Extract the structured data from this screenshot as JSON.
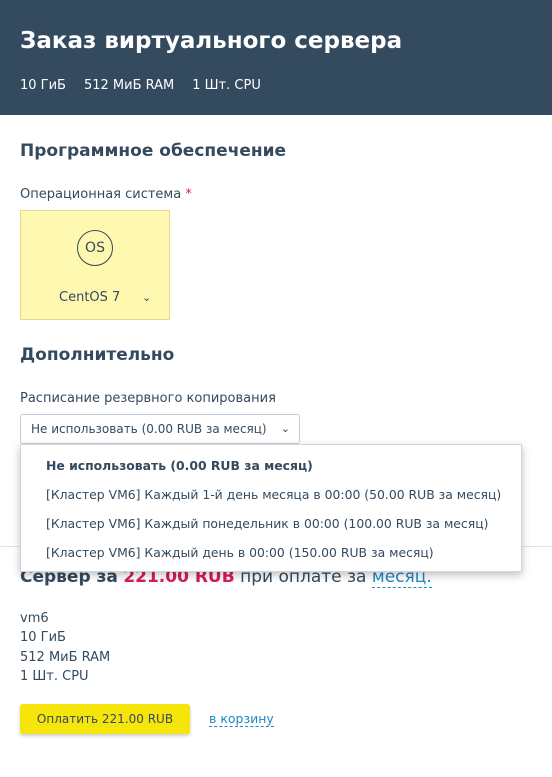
{
  "header": {
    "title": "Заказ виртуального сервера",
    "specs": [
      "10 ГиБ",
      "512 МиБ RAM",
      "1 Шт. CPU"
    ]
  },
  "software": {
    "section_title": "Программное обеспечение",
    "os_label": "Операционная система",
    "required_mark": "*",
    "os_icon_text": "OS",
    "os_value": "CentOS 7"
  },
  "additional": {
    "section_title": "Дополнительно",
    "backup_label": "Расписание резервного копирования",
    "backup_selected": "Не использовать (0.00 RUB за месяц)",
    "backup_options": [
      "Не использовать (0.00 RUB за месяц)",
      "[Кластер VM6] Каждый 1-й день месяца в 00:00 (50.00 RUB за месяц)",
      "[Кластер VM6] Каждый понедельник в 00:00 (100.00 RUB за месяц)",
      "[Кластер VM6] Каждый день в 00:00 (150.00 RUB за месяц)"
    ]
  },
  "summary": {
    "prefix": "Сервер за",
    "price": "221.00 RUB",
    "middle": "при оплате за",
    "period": "месяц.",
    "details": [
      "vm6",
      "10 ГиБ",
      "512 МиБ RAM",
      "1 Шт. CPU"
    ],
    "pay_label": "Оплатить 221.00 RUB",
    "cart_label": "в корзину"
  },
  "colors": {
    "header_bg": "#344a5e",
    "accent_price": "#d81b60",
    "link": "#1e88c7",
    "pay_button": "#f5e50a",
    "os_card_bg": "#fff8b0"
  }
}
